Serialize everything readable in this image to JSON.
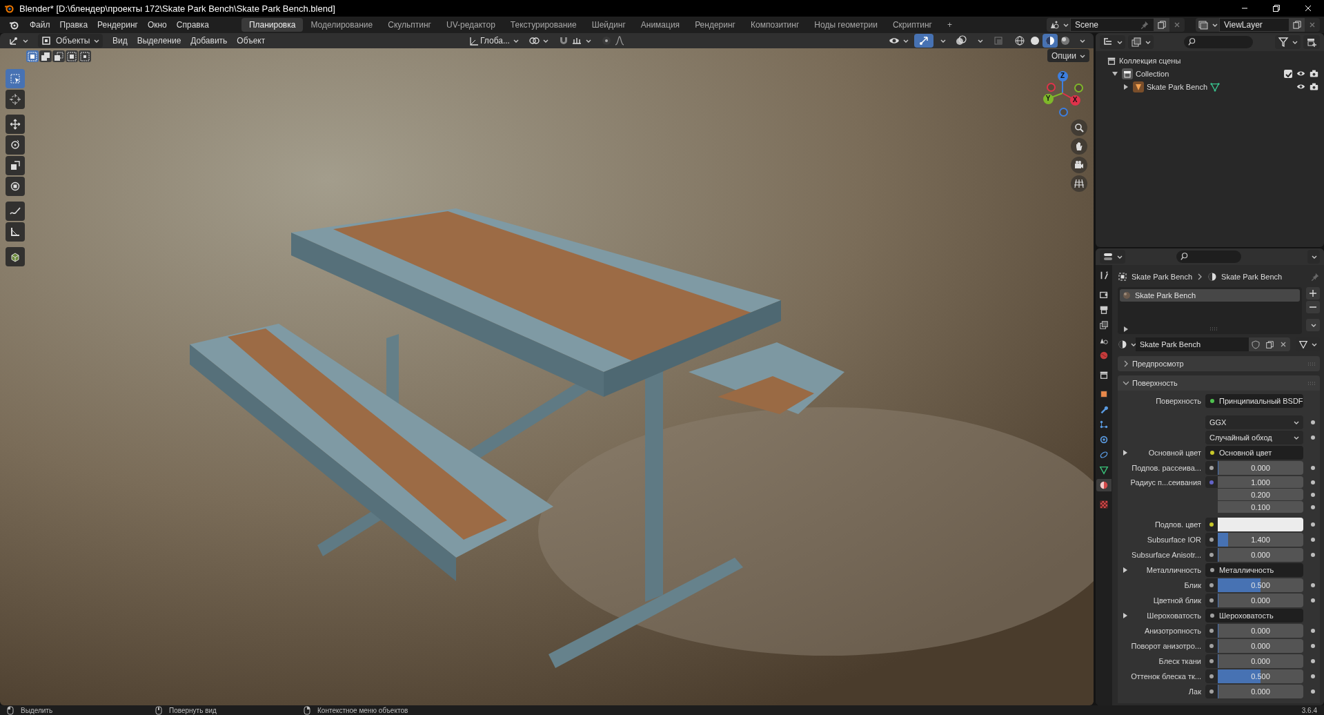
{
  "window": {
    "title": "Blender* [D:\\блендер\\проекты 172\\Skate Park Bench\\Skate Park Bench.blend]"
  },
  "menu": [
    "Файл",
    "Правка",
    "Рендеринг",
    "Окно",
    "Справка"
  ],
  "workspaces": [
    {
      "label": "Планировка",
      "selected": true
    },
    {
      "label": "Моделирование",
      "selected": false
    },
    {
      "label": "Скульптинг",
      "selected": false
    },
    {
      "label": "UV-редактор",
      "selected": false
    },
    {
      "label": "Текстурирование",
      "selected": false
    },
    {
      "label": "Шейдинг",
      "selected": false
    },
    {
      "label": "Анимация",
      "selected": false
    },
    {
      "label": "Рендеринг",
      "selected": false
    },
    {
      "label": "Композитинг",
      "selected": false
    },
    {
      "label": "Ноды геометрии",
      "selected": false
    },
    {
      "label": "Скриптинг",
      "selected": false
    }
  ],
  "add_workspace": "+",
  "scene": {
    "name": "Scene"
  },
  "view_layer": {
    "name": "ViewLayer"
  },
  "viewport": {
    "mode": "Объекты",
    "menus": [
      "Вид",
      "Выделение",
      "Добавить",
      "Объект"
    ],
    "orientation": "Глоба...",
    "options": "Опции",
    "select_modes": [
      {
        "kind": "set",
        "selected": true
      },
      {
        "kind": "extend",
        "selected": false
      },
      {
        "kind": "subtract",
        "selected": false
      },
      {
        "kind": "invert",
        "selected": false
      },
      {
        "kind": "intersect",
        "selected": false
      }
    ],
    "tools": [
      {
        "kind": "select",
        "selected": true
      },
      {
        "kind": "cursor",
        "selected": false
      },
      {
        "kind": "move",
        "selected": false
      },
      {
        "kind": "rotate",
        "selected": false
      },
      {
        "kind": "scale",
        "selected": false
      },
      {
        "kind": "transform",
        "selected": false
      },
      {
        "kind": "annotate",
        "selected": false
      },
      {
        "kind": "measure",
        "selected": false
      },
      {
        "kind": "add_cube",
        "selected": false
      }
    ],
    "gizmo_axes": [
      {
        "label": "Z",
        "color": "#3d7fe0"
      },
      {
        "label": "Y",
        "color": "#7fb82a"
      },
      {
        "label": "X",
        "color": "#e0334b"
      }
    ],
    "toggles": [
      {
        "kind": "gizmo",
        "on": true
      },
      {
        "kind": "overlays",
        "on": false
      },
      {
        "kind": "xray",
        "on": false
      }
    ],
    "shading": [
      {
        "kind": "wireframe",
        "selected": false
      },
      {
        "kind": "solid",
        "selected": false
      },
      {
        "kind": "material",
        "selected": true
      },
      {
        "kind": "rendered",
        "selected": false
      }
    ]
  },
  "outliner": {
    "root": {
      "name": "Коллекция сцены",
      "children": [
        {
          "name": "Collection",
          "kind": "collection",
          "expanded": true,
          "checked": true,
          "children": [
            {
              "name": "Skate Park Bench",
              "kind": "object",
              "expanded": false
            }
          ]
        }
      ]
    }
  },
  "properties": {
    "tabs": [
      {
        "kind": "tool",
        "selected": false
      },
      {
        "kind": "render",
        "selected": false
      },
      {
        "kind": "output",
        "selected": false
      },
      {
        "kind": "view_layer",
        "selected": false
      },
      {
        "kind": "scene",
        "selected": false
      },
      {
        "kind": "world",
        "selected": false
      },
      {
        "kind": "collection",
        "selected": false
      },
      {
        "kind": "object",
        "selected": false
      },
      {
        "kind": "modifiers",
        "selected": false
      },
      {
        "kind": "particles",
        "selected": false
      },
      {
        "kind": "physics",
        "selected": false
      },
      {
        "kind": "constraints",
        "selected": false
      },
      {
        "kind": "data",
        "selected": false
      },
      {
        "kind": "material",
        "selected": true
      },
      {
        "kind": "texture",
        "selected": false
      }
    ],
    "breadcrumb": [
      "Skate Park Bench",
      "Skate Park Bench"
    ],
    "slots": [
      {
        "name": "Skate Park Bench",
        "selected": true
      }
    ],
    "material": "Skate Park Bench",
    "panels": [
      {
        "title": "Предпросмотр",
        "expanded": false
      },
      {
        "title": "Поверхность",
        "expanded": true,
        "rows": [
          {
            "kind": "link",
            "label": "Поверхность",
            "color": "#4fc24f",
            "value": "Принципиальный BSDF",
            "expandable": false
          },
          {
            "kind": "enum",
            "value": "GGX"
          },
          {
            "kind": "enum",
            "value": "Случайный обход"
          },
          {
            "kind": "link",
            "label": "Основной цвет",
            "color": "#c7c729",
            "value": "Основной цвет",
            "expandable": true
          },
          {
            "kind": "value",
            "label": "Подпов. рассеива...",
            "color": "#a1a1a1",
            "value": "0.000",
            "level": 0
          },
          {
            "kind": "vector",
            "label": "Радиус п...сеивания",
            "color": "#6363c7",
            "values": [
              "1.000",
              "0.200",
              "0.100"
            ]
          },
          {
            "kind": "color",
            "label": "Подпов. цвет",
            "color": "#c7c729"
          },
          {
            "kind": "value",
            "label": "Subsurface IOR",
            "color": "#a1a1a1",
            "value": "1.400",
            "level": 0.12
          },
          {
            "kind": "value",
            "label": "Subsurface Anisotr...",
            "color": "#a1a1a1",
            "value": "0.000",
            "level": 0
          },
          {
            "kind": "link",
            "label": "Металличность",
            "color": "#a1a1a1",
            "value": "Металличность",
            "expandable": true
          },
          {
            "kind": "value",
            "label": "Блик",
            "color": "#a1a1a1",
            "value": "0.500",
            "level": 0.5
          },
          {
            "kind": "value",
            "label": "Цветной блик",
            "color": "#a1a1a1",
            "value": "0.000",
            "level": 0
          },
          {
            "kind": "link",
            "label": "Шероховатость",
            "color": "#a1a1a1",
            "value": "Шероховатость",
            "expandable": true
          },
          {
            "kind": "value",
            "label": "Анизотропность",
            "color": "#a1a1a1",
            "value": "0.000",
            "level": 0
          },
          {
            "kind": "value",
            "label": "Поворот анизотро...",
            "color": "#a1a1a1",
            "value": "0.000",
            "level": 0
          },
          {
            "kind": "value",
            "label": "Блеск ткани",
            "color": "#a1a1a1",
            "value": "0.000",
            "level": 0
          },
          {
            "kind": "value",
            "label": "Оттенок блеска тк...",
            "color": "#a1a1a1",
            "value": "0.500",
            "level": 0.5
          },
          {
            "kind": "value",
            "label": "Лак",
            "color": "#a1a1a1",
            "value": "0.000",
            "level": 0
          }
        ]
      }
    ]
  },
  "status_bar": {
    "hints": [
      {
        "kind": "left",
        "text": "Выделить"
      },
      {
        "kind": "middle",
        "text": "Повернуть вид"
      },
      {
        "kind": "right",
        "text": "Контекстное меню объектов"
      }
    ],
    "version": "3.6.4"
  }
}
